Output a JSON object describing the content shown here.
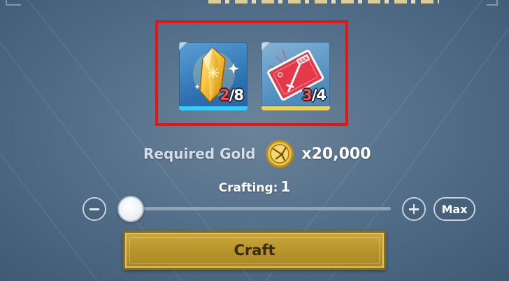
{
  "materials": [
    {
      "icon": "yellow-crystal-icon",
      "have": "2",
      "need": "/8",
      "frame_color": "#2fd0ff"
    },
    {
      "icon": "ssr-weapon-ticket-icon",
      "have": "3",
      "need": "/4",
      "frame_color": "#f2d24a"
    }
  ],
  "required_gold": {
    "label": "Required Gold",
    "icon": "gold-coin-icon",
    "amount": "x20,000"
  },
  "crafting": {
    "label": "Crafting:",
    "quantity": "1"
  },
  "quantity_slider": {
    "value": 1,
    "min": 1
  },
  "controls": {
    "minus_icon": "minus-icon",
    "plus_icon": "plus-icon",
    "max_label": "Max"
  },
  "craft_button": {
    "label": "Craft"
  },
  "colors": {
    "highlight_border": "#f01010",
    "craft_button": "#b8952c",
    "have_count_insufficient": "#ff4a4a"
  }
}
